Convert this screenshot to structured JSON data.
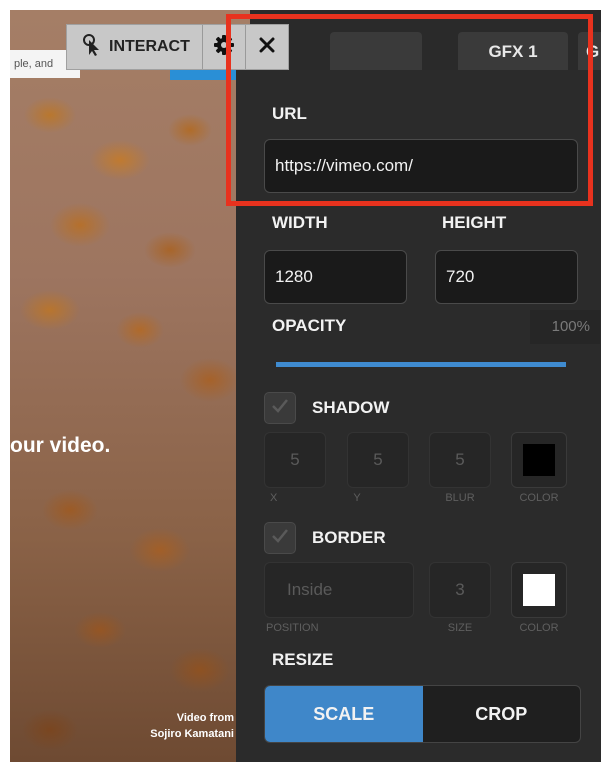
{
  "video": {
    "top_input_text": "ple, and",
    "caption": "our video.",
    "credit_line1": "Video from",
    "credit_line2": "Sojiro Kamatani"
  },
  "toolbar": {
    "interact_label": "INTERACT",
    "icons": [
      "pointer-icon",
      "gear-icon",
      "close-icon"
    ]
  },
  "tabs": {
    "gfx1": "GFX 1",
    "partial": "G"
  },
  "panel": {
    "url_label": "URL",
    "url_value": "https://vimeo.com/",
    "width_label": "WIDTH",
    "width_value": "1280",
    "height_label": "HEIGHT",
    "height_value": "720",
    "opacity_label": "OPACITY",
    "opacity_value": "100%",
    "opacity_level": 1.0,
    "shadow": {
      "label": "SHADOW",
      "checked": true,
      "x": "5",
      "y": "5",
      "blur": "5",
      "x_caption": "X",
      "y_caption": "Y",
      "blur_caption": "BLUR",
      "color_caption": "COLOR",
      "color": "#000000"
    },
    "border": {
      "label": "BORDER",
      "checked": true,
      "position": "Inside",
      "size": "3",
      "position_caption": "POSITION",
      "size_caption": "SIZE",
      "color_caption": "COLOR",
      "color": "#ffffff"
    },
    "resize": {
      "label": "RESIZE",
      "options": [
        "SCALE",
        "CROP"
      ],
      "selected": "SCALE"
    }
  },
  "colors": {
    "highlight": "#e8321e",
    "accent": "#3f87c9",
    "panel_bg": "#2b2b2b"
  }
}
